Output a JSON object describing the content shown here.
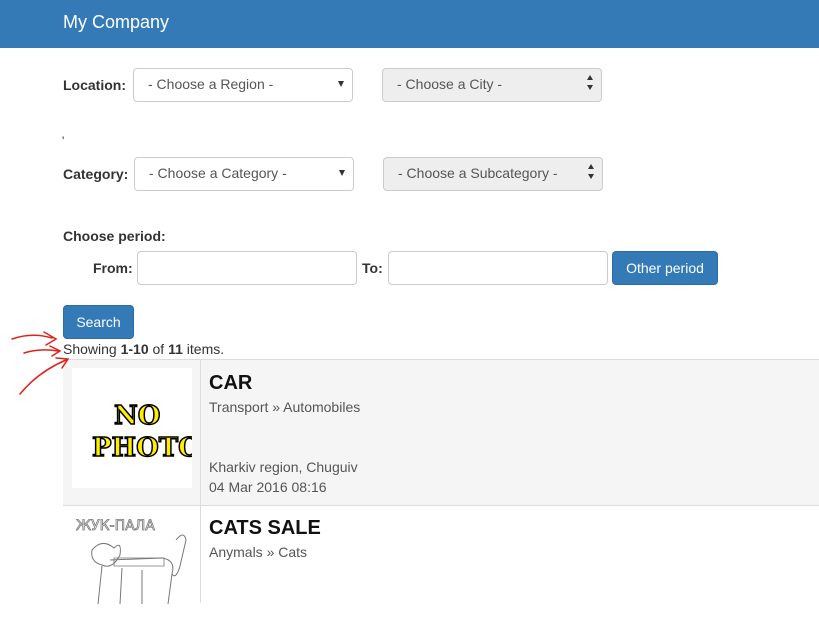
{
  "navbar": {
    "brand": "My Company"
  },
  "filters": {
    "location_label": "Location:",
    "region_placeholder": "- Choose a Region -",
    "city_placeholder": "- Choose a City -",
    "tick_mark": "'",
    "category_label": "Category:",
    "category_placeholder": "- Choose a Category -",
    "subcategory_placeholder": "- Choose a Subcategory -",
    "period_label": "Choose period:",
    "from_label": "From:",
    "from_value": "",
    "to_label": "To:",
    "to_value": "",
    "other_period_label": "Other period",
    "search_label": "Search"
  },
  "results": {
    "summary_prefix": "Showing ",
    "summary_range": "1-10",
    "summary_of": " of ",
    "summary_total": "11",
    "summary_suffix": " items.",
    "items": [
      {
        "title": "CAR",
        "category": "Transport » Automobiles",
        "location": "Kharkiv region, Chuguiv",
        "date": "04 Mar 2016 08:16",
        "image_text": [
          "NO",
          "PHOTO"
        ]
      },
      {
        "title": "CATS SALE",
        "category": "Anymals » Cats",
        "sketch_text": "ЖУК-ПАЛА"
      }
    ]
  },
  "colors": {
    "primary": "#337ab7",
    "annotation": "#e0201b",
    "nophoto_fill": "#ffee00"
  }
}
